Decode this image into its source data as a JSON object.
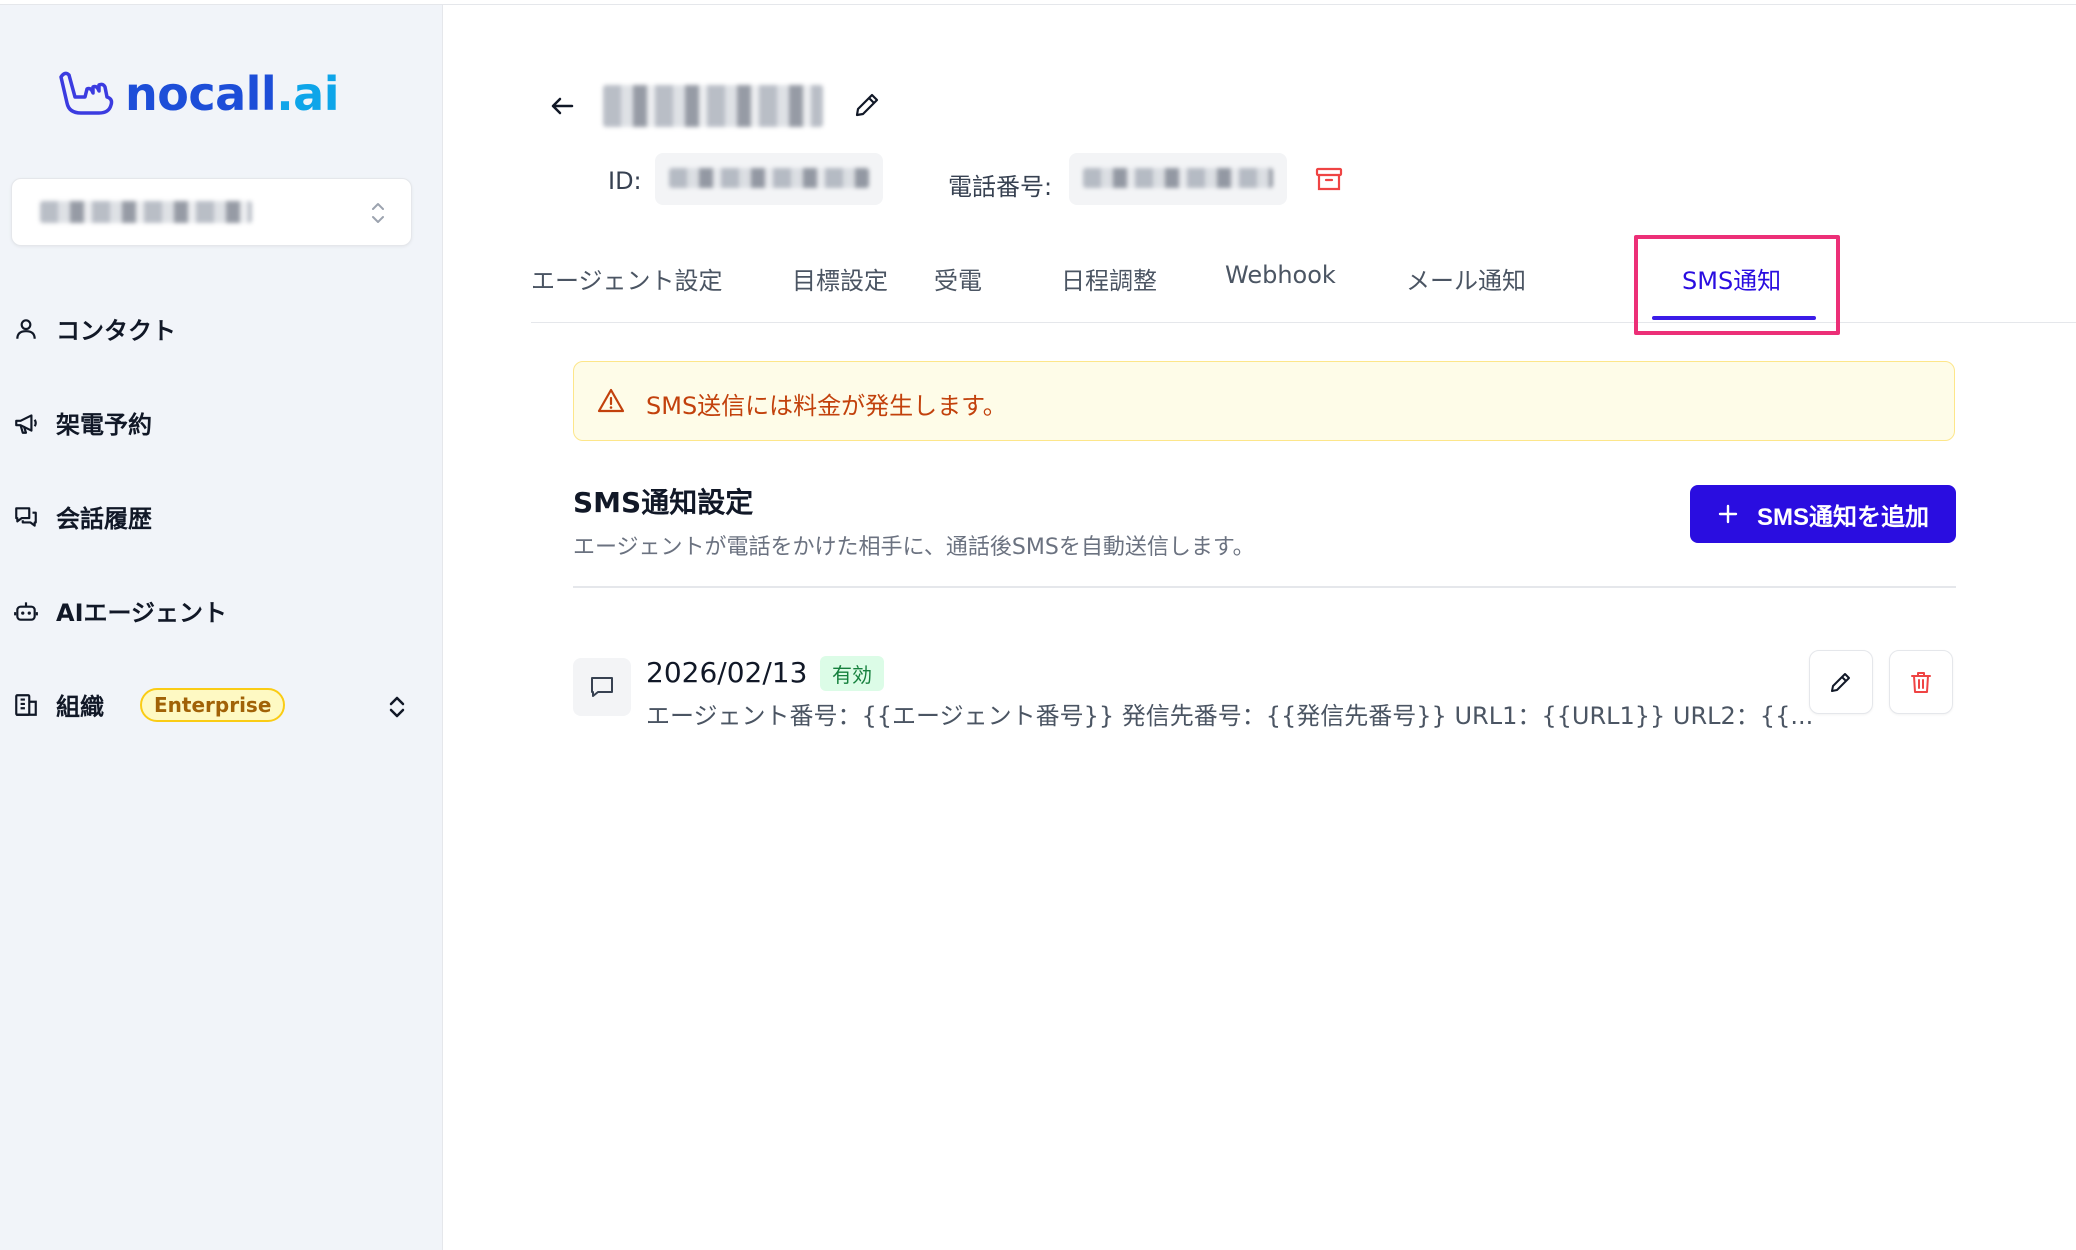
{
  "brand": {
    "name": "nocall",
    "suffix": ".ai"
  },
  "sidebar": {
    "items": [
      {
        "label": "コンタクト",
        "icon": "user-icon"
      },
      {
        "label": "架電予約",
        "icon": "megaphone-icon"
      },
      {
        "label": "会話履歴",
        "icon": "chat-bubbles-icon"
      },
      {
        "label": "AIエージェント",
        "icon": "bot-icon"
      },
      {
        "label": "組織",
        "icon": "building-icon",
        "badge": "Enterprise"
      }
    ]
  },
  "header": {
    "id_label": "ID:",
    "phone_label": "電話番号:"
  },
  "tabs": [
    {
      "label": "エージェント設定"
    },
    {
      "label": "目標設定"
    },
    {
      "label": "受電"
    },
    {
      "label": "日程調整"
    },
    {
      "label": "Webhook"
    },
    {
      "label": "メール通知"
    },
    {
      "label": "SMS通知",
      "active": true
    }
  ],
  "warning": {
    "text": "SMS送信には料金が発生します。"
  },
  "section": {
    "title": "SMS通知設定",
    "description": "エージェントが電話をかけた相手に、通話後SMSを自動送信します。",
    "add_button": "SMS通知を追加"
  },
  "sms_items": [
    {
      "date": "2026/02/13",
      "status": "有効",
      "body": "エージェント番号：{{エージェント番号}} 発信先番号：{{発信先番号}} URL1：{{URL1}} URL2：{{..."
    }
  ],
  "colors": {
    "primary": "#2a0de0",
    "highlight": "#ec2f77",
    "warning_text": "#c2410c",
    "danger": "#ef4444"
  }
}
